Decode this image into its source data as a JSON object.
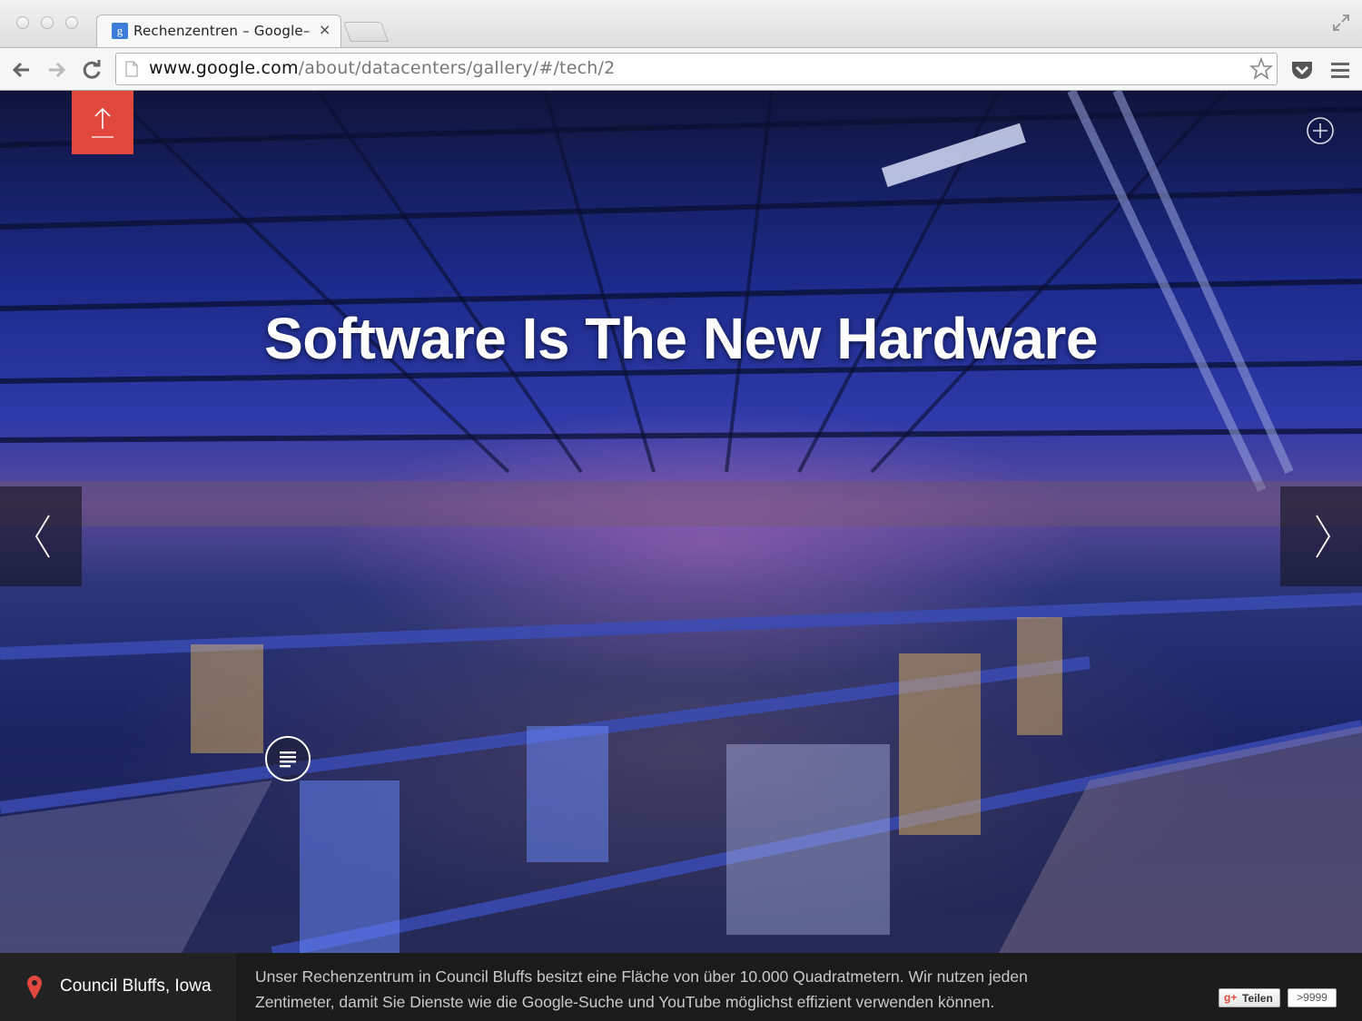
{
  "browser": {
    "tab_title": "Rechenzentren – Google–R",
    "tab_favicon": "g",
    "tab_close": "×",
    "url_host": "www.google.com",
    "url_path": "/about/datacenters/gallery/#/tech/2"
  },
  "gallery": {
    "headline": "Software Is The New Hardware",
    "location": "Council Bluffs, Iowa",
    "description": "Unser Rechenzentrum in Council Bluffs besitzt eine Fläche von über 10.000 Quadratmetern. Wir nutzen jeden Zentimeter, damit Sie Dienste wie die Google-Suche und YouTube möglichst effizient verwenden können.",
    "share_label": "Teilen",
    "share_icon": "g+",
    "share_count": ">9999"
  },
  "icons": {
    "upload": "upload-arrow-icon",
    "zoom": "plus-circle-icon",
    "prev": "chevron-left-icon",
    "next": "chevron-right-icon",
    "list": "list-icon",
    "pin": "map-pin-icon"
  },
  "colors": {
    "accent_red": "#e0483e",
    "footer_bg": "#1b1b1b"
  }
}
